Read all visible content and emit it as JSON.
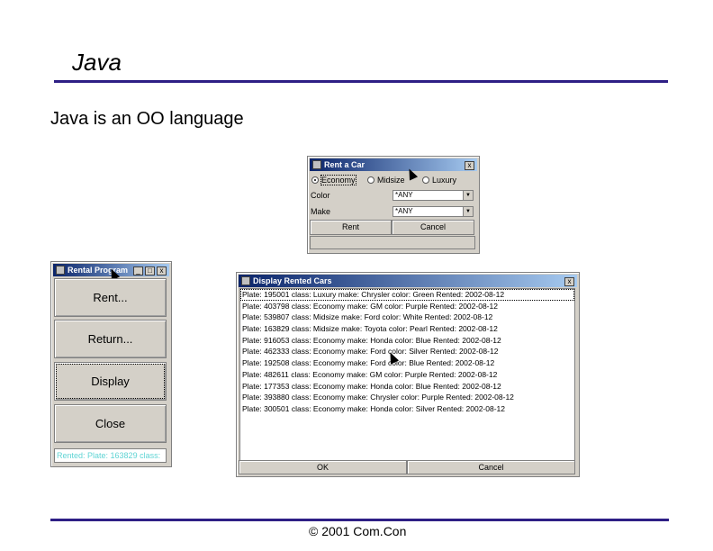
{
  "slide": {
    "title": "Java",
    "subtitle": "Java is an OO language",
    "footer": "© 2001 Com.Con"
  },
  "rent_window": {
    "title": "Rent a Car",
    "close_glyph": "x",
    "radio_economy": "Economy",
    "radio_midsize": "Midsize",
    "radio_luxury": "Luxury",
    "selected": "Economy",
    "color_label": "Color",
    "color_value": "*ANY",
    "make_label": "Make",
    "make_value": "*ANY",
    "rent_button": "Rent",
    "cancel_button": "Cancel"
  },
  "program_window": {
    "title": "Rental Program",
    "min_glyph": "_",
    "max_glyph": "□",
    "close_glyph": "x",
    "buttons": [
      "Rent...",
      "Return...",
      "Display",
      "Close"
    ],
    "status": "Rented: Plate: 163829 class:"
  },
  "display_window": {
    "title": "Display Rented Cars",
    "close_glyph": "x",
    "rows": [
      "Plate: 195001 class: Luxury make: Chrysler color: Green Rented: 2002-08-12",
      "Plate: 403798 class: Economy make: GM color: Purple Rented: 2002-08-12",
      "Plate: 539807 class: Midsize make: Ford color: White Rented: 2002-08-12",
      "Plate: 163829 class: Midsize make: Toyota color: Pearl Rented: 2002-08-12",
      "Plate: 916053 class: Economy make: Honda color: Blue Rented: 2002-08-12",
      "Plate: 462333 class: Economy make: Ford color: Silver Rented: 2002-08-12",
      "Plate: 192508 class: Economy make: Ford color: Blue Rented: 2002-08-12",
      "Plate: 482611 class: Economy make: GM color: Purple Rented: 2002-08-12",
      "Plate: 177353 class: Economy make: Honda color: Blue Rented: 2002-08-12",
      "Plate: 393880 class: Economy make: Chrysler color: Purple Rented: 2002-08-12",
      "Plate: 300501 class: Economy make: Honda color: Silver Rented: 2002-08-12"
    ],
    "ok_button": "OK",
    "cancel_button": "Cancel"
  },
  "colors": {
    "rule": "#2e1f85",
    "window_face": "#d4d0c8",
    "titlebar_start": "#0a246a",
    "status_text": "#5fd4d4"
  }
}
